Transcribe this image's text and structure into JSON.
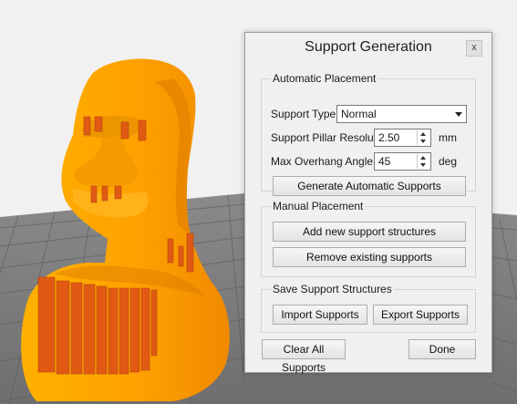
{
  "dialog": {
    "title": "Support Generation",
    "close_label": "x",
    "automatic": {
      "group_label": "Automatic Placement",
      "support_type_label": "Support Type",
      "support_type_value": "Normal",
      "pillar_label": "Support Pillar Resolution",
      "pillar_value": "2.50",
      "pillar_unit": "mm",
      "angle_label": "Max Overhang Angle",
      "angle_value": "45",
      "angle_unit": "deg",
      "generate_button": "Generate Automatic Supports"
    },
    "manual": {
      "group_label": "Manual Placement",
      "add_button": "Add new support structures",
      "remove_button": "Remove existing supports"
    },
    "save": {
      "group_label": "Save Support Structures",
      "import_button": "Import Supports",
      "export_button": "Export Supports"
    },
    "clear_button": "Clear All Supports",
    "done_button": "Done"
  },
  "colors": {
    "model": "#ffa400",
    "supports": "#e05a14",
    "background": "#f1f1f1",
    "bed": "#7a7a7a"
  }
}
